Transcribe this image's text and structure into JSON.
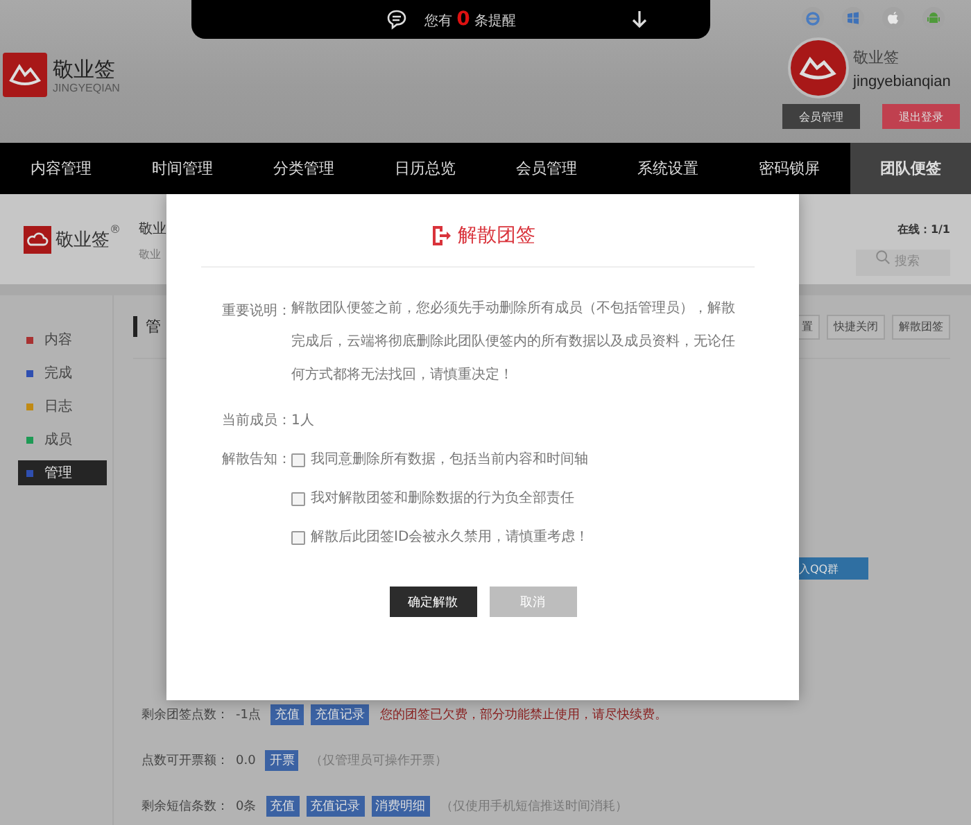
{
  "notification_bar": {
    "prefix": "您有",
    "count": "0",
    "suffix": "条提醒"
  },
  "logo": {
    "name": "敬业签",
    "subtitle": "JINGYEQIAN"
  },
  "user": {
    "name": "敬业签",
    "account": "jingyebianqian",
    "buttons": [
      "会员管理",
      "退出登录"
    ]
  },
  "nav": [
    {
      "label": "内容管理",
      "selected": false
    },
    {
      "label": "时间管理",
      "selected": false
    },
    {
      "label": "分类管理",
      "selected": false
    },
    {
      "label": "日历总览",
      "selected": false
    },
    {
      "label": "会员管理",
      "selected": false
    },
    {
      "label": "系统设置",
      "selected": false
    },
    {
      "label": "密码锁屏",
      "selected": false
    },
    {
      "label": "团队便签",
      "selected": true
    }
  ],
  "team_header": {
    "logo": "敬业签",
    "registered": "®",
    "title": "敬业",
    "subtitle": "敬业",
    "online": "在线：1/1",
    "search_placeholder": "搜索"
  },
  "side_menu": [
    {
      "label": "内容",
      "color": "#a83232",
      "selected": false
    },
    {
      "label": "完成",
      "color": "#2f4fb0",
      "selected": false
    },
    {
      "label": "日志",
      "color": "#c08a14",
      "selected": false
    },
    {
      "label": "成员",
      "color": "#1e9a55",
      "selected": false
    },
    {
      "label": "管理",
      "color": "#2f4fb0",
      "selected": true
    }
  ],
  "panel": {
    "heading": "管",
    "actions": [
      "置",
      "快捷关闭",
      "解散团签"
    ],
    "qq_button": "入QQ群",
    "rows": [
      {
        "label": "剩余团签点数：",
        "value": "-1点",
        "buttons": [
          "充值",
          "充值记录"
        ],
        "note": "您的团签已欠费，部分功能禁止使用，请尽快续费。",
        "kind": "warning"
      },
      {
        "label": "点数可开票额：",
        "value": "0.0",
        "buttons": [
          "开票"
        ],
        "note": "（仅管理员可操作开票）",
        "kind": "hint"
      },
      {
        "label": "剩余短信条数：",
        "value": "0条",
        "buttons": [
          "充值",
          "充值记录",
          "消费明细"
        ],
        "note": "（仅使用手机短信推送时间消耗）",
        "kind": "hint"
      }
    ]
  },
  "dialog": {
    "title": "解散团签",
    "notice_label": "重要说明：",
    "notice": "解散团队便签之前，您必须先手动删除所有成员（不包括管理员），解散完成后，云端将彻底删除此团队便签内的所有数据以及成员资料，无论任何方式都将无法找回，请慎重决定！",
    "members_label": "当前成员：",
    "members": "1人",
    "agree_label": "解散告知：",
    "agreements": [
      {
        "text": "我同意删除所有数据，包括当前内容和时间轴",
        "checked": false
      },
      {
        "text": "我对解散团签和删除数据的行为负全部责任",
        "checked": false
      },
      {
        "text": "解散后此团签ID会被永久禁用，请慎重考虑！",
        "checked": false
      }
    ],
    "buttons": [
      "确定解散",
      "取消"
    ]
  }
}
